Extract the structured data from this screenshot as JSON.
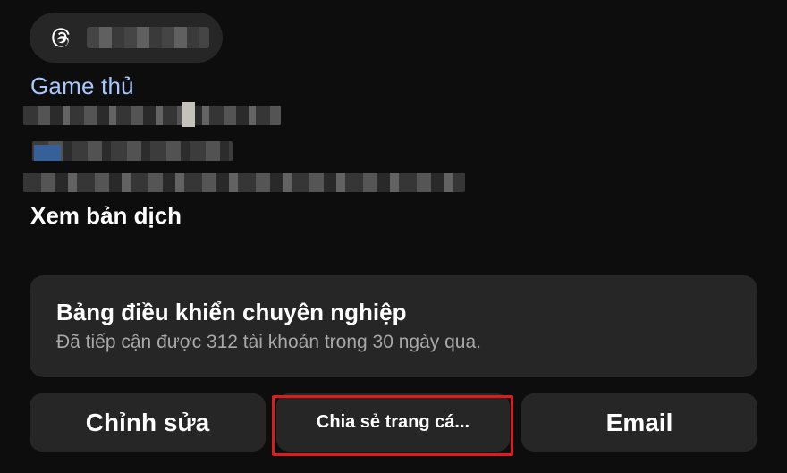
{
  "profile": {
    "category": "Game thủ",
    "see_translation": "Xem bản dịch"
  },
  "threads_badge": {
    "icon": "threads-icon"
  },
  "dashboard": {
    "title": "Bảng điều khiển chuyên nghiệp",
    "subtitle": "Đã tiếp cận được 312 tài khoản trong 30 ngày qua."
  },
  "actions": {
    "edit_label": "Chỉnh sửa",
    "share_label": "Chia sẻ trang cá...",
    "email_label": "Email"
  },
  "colors": {
    "background": "#0d0d0d",
    "surface": "#262626",
    "link": "#a8c7ff",
    "highlight": "#e01b1b"
  }
}
